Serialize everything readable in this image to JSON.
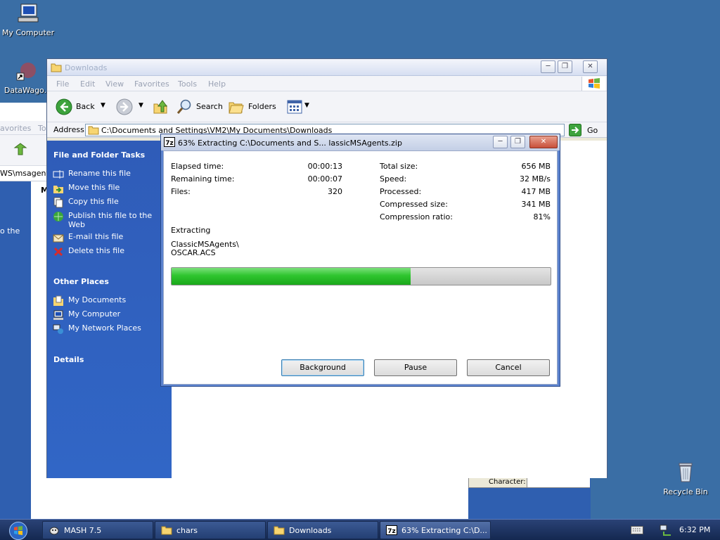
{
  "desktop": {
    "icons": [
      {
        "label": "My Computer"
      },
      {
        "label": "DataWago."
      },
      {
        "label": "Recycle Bin"
      }
    ],
    "bg_fragments": {
      "favorites": "avorites",
      "to": "To",
      "path": "WS\\msagent",
      "m": "M",
      "the": "o the",
      "character": "Character:"
    }
  },
  "explorer": {
    "title": "Downloads",
    "menu": [
      "File",
      "Edit",
      "View",
      "Favorites",
      "Tools",
      "Help"
    ],
    "toolbar": {
      "back": "Back",
      "search": "Search",
      "folders": "Folders"
    },
    "address_label": "Address",
    "address_value": "C:\\Documents and Settings\\VM2\\My Documents\\Downloads",
    "go": "Go",
    "task_pane": {
      "file_tasks_heading": "File and Folder Tasks",
      "file_tasks": [
        "Rename this file",
        "Move this file",
        "Copy this file",
        "Publish this file to the Web",
        "E-mail this file",
        "Delete this file"
      ],
      "other_places_heading": "Other Places",
      "other_places": [
        "My Documents",
        "My Computer",
        "My Network Places"
      ],
      "details_heading": "Details"
    }
  },
  "dialog": {
    "title": "63% Extracting C:\\Documents and S... lassicMSAgents.zip",
    "elapsed_label": "Elapsed time:",
    "elapsed_value": "00:00:13",
    "remaining_label": "Remaining time:",
    "remaining_value": "00:00:07",
    "files_label": "Files:",
    "files_value": "320",
    "total_label": "Total size:",
    "total_value": "656 MB",
    "speed_label": "Speed:",
    "speed_value": "32 MB/s",
    "processed_label": "Processed:",
    "processed_value": "417 MB",
    "compressed_label": "Compressed size:",
    "compressed_value": "341 MB",
    "ratio_label": "Compression ratio:",
    "ratio_value": "81%",
    "status": "Extracting",
    "current_path": "ClassicMSAgents\\",
    "current_file": "OSCAR.ACS",
    "progress_fraction": 0.63,
    "buttons": {
      "background": "Background",
      "pause": "Pause",
      "cancel": "Cancel"
    }
  },
  "taskbar": {
    "tasks": [
      {
        "label": "MASH 7.5"
      },
      {
        "label": "chars"
      },
      {
        "label": "Downloads"
      },
      {
        "label": "63% Extracting C:\\D..."
      }
    ],
    "clock": "6:32 PM"
  },
  "colors": {
    "desktop": "#3a6ea5",
    "task_pane": "#3166c6",
    "progress": "#2fc52f"
  }
}
